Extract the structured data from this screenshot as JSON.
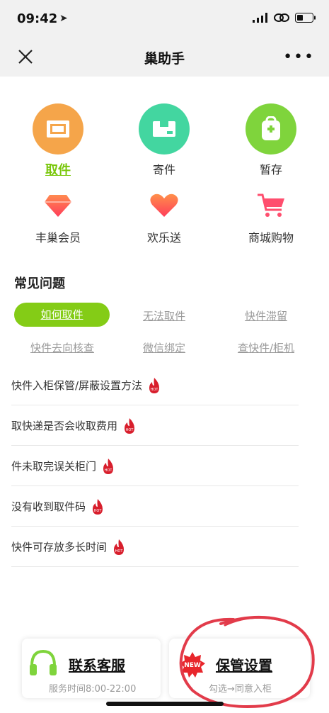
{
  "status": {
    "time": "09:42"
  },
  "nav": {
    "title": "巢助手",
    "more": "•••"
  },
  "grid": [
    {
      "label": "取件",
      "icon": "box-icon",
      "color": "#f5a54a"
    },
    {
      "label": "寄件",
      "icon": "package-icon",
      "color": "#43d6a0"
    },
    {
      "label": "暂存",
      "icon": "backpack-icon",
      "color": "#7fd43c"
    },
    {
      "label": "丰巢会员",
      "icon": "diamond-icon",
      "color": "#ff5a55"
    },
    {
      "label": "欢乐送",
      "icon": "heart-icon",
      "color": "#ff6b55"
    },
    {
      "label": "商城购物",
      "icon": "cart-icon",
      "color": "#ff4e6e"
    }
  ],
  "faq": {
    "title": "常见问题",
    "tags": [
      "如何取件",
      "无法取件",
      "快件滞留",
      "快件去向核查",
      "微信绑定",
      "查快件/柜机"
    ],
    "items": [
      "快件入柜保管/屏蔽设置方法",
      "取快递是否会收取费用",
      "件未取完误关柜门",
      "没有收到取件码",
      "快件可存放多长时间"
    ],
    "hot_label": "HOT"
  },
  "bottom": {
    "service": {
      "title": "联系客服",
      "sub": "服务时间8:00-22:00"
    },
    "storage": {
      "title": "保管设置",
      "sub": "勾选→同意入柜",
      "badge": "NEW"
    }
  }
}
